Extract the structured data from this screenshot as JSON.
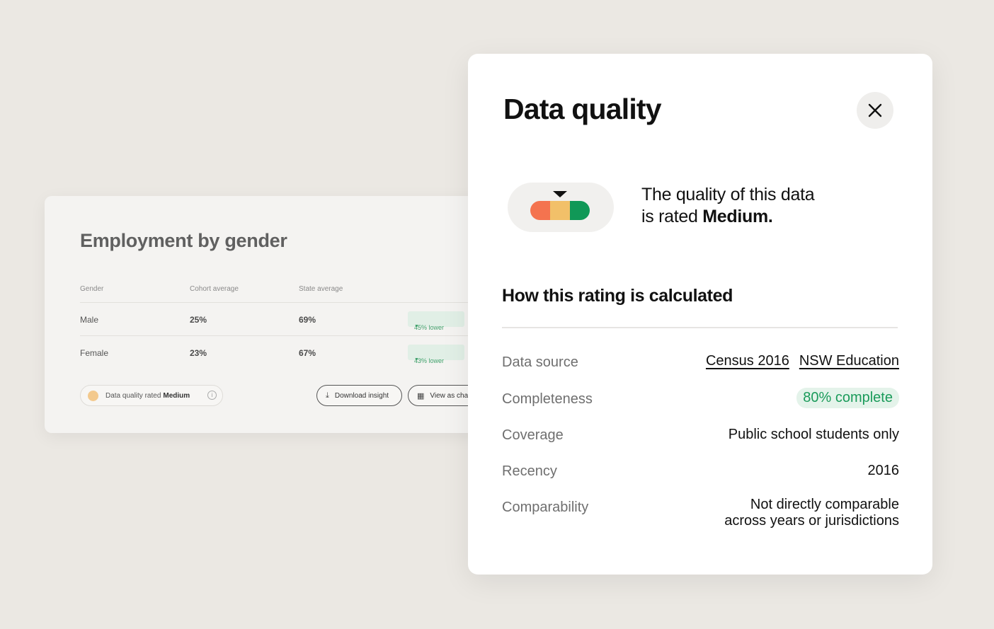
{
  "background_card": {
    "title": "Employment by gender",
    "columns": [
      "Gender",
      "Cohort average",
      "State average"
    ],
    "rows": [
      {
        "gender": "Male",
        "cohort": "25%",
        "state": "69%",
        "diff": "45% lower"
      },
      {
        "gender": "Female",
        "cohort": "23%",
        "state": "67%",
        "diff": "43% lower"
      }
    ],
    "quality_chip": {
      "prefix": "Data quality rated",
      "rating": "Medium"
    },
    "buttons": {
      "download": "Download insight",
      "view_chart": "View as cha"
    }
  },
  "modal": {
    "title": "Data quality",
    "close_icon": "close-icon",
    "rating_line1": "The quality of this data",
    "rating_line2_prefix": "is rated ",
    "rating_value": "Medium.",
    "meter_colors": {
      "low": "#f4734f",
      "medium": "#f2c069",
      "high": "#109857"
    },
    "section_title": "How this rating is calculated",
    "rows": {
      "data_source": {
        "label": "Data source",
        "links": [
          "Census 2016",
          "NSW Education"
        ]
      },
      "completeness": {
        "label": "Completeness",
        "value": "80% complete"
      },
      "coverage": {
        "label": "Coverage",
        "value": "Public school students only"
      },
      "recency": {
        "label": "Recency",
        "value": "2016"
      },
      "comparability": {
        "label": "Comparability",
        "value_line1": "Not directly comparable",
        "value_line2": "across years or jurisdictions"
      }
    }
  }
}
